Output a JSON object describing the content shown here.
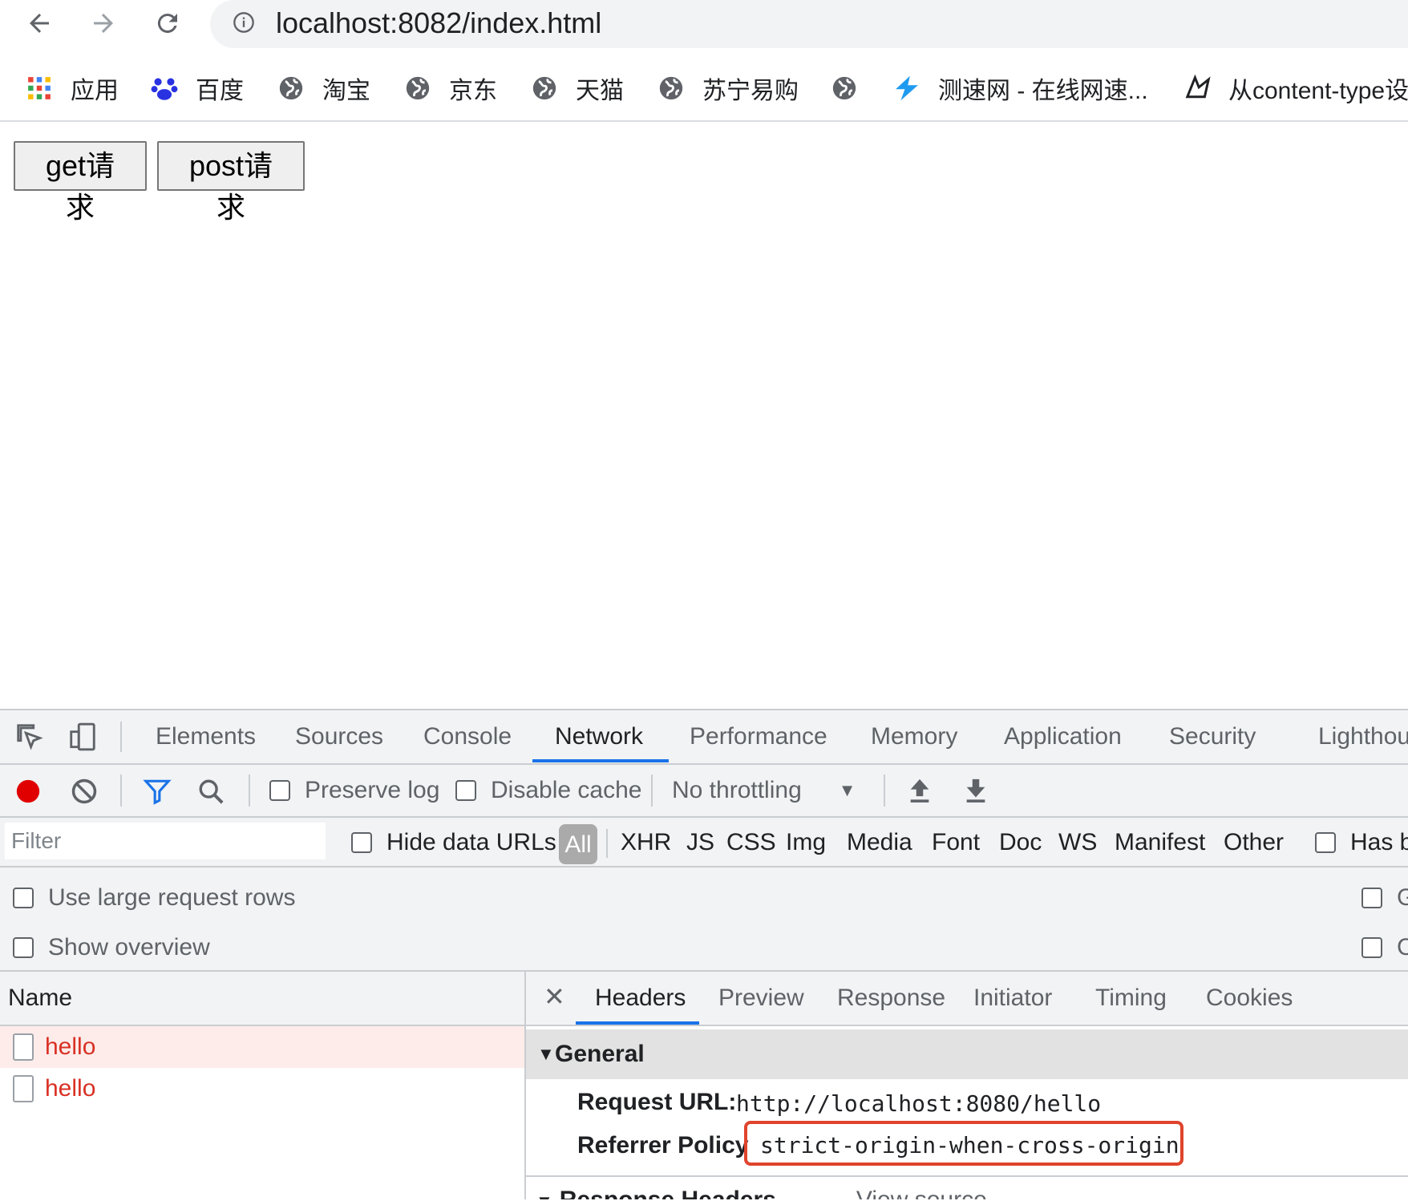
{
  "browser": {
    "url": "localhost:8082/index.html",
    "bookmarks": [
      {
        "label": "应用",
        "icon": "apps-grid-icon"
      },
      {
        "label": "百度",
        "icon": "baidu-paw-icon"
      },
      {
        "label": "淘宝",
        "icon": "globe-icon"
      },
      {
        "label": "京东",
        "icon": "globe-icon"
      },
      {
        "label": "天猫",
        "icon": "globe-icon"
      },
      {
        "label": "苏宁易购",
        "icon": "globe-icon"
      },
      {
        "label": "",
        "icon": "globe-icon"
      },
      {
        "label": "测速网 - 在线网速...",
        "icon": "speedtest-logo-icon"
      },
      {
        "label": "从content-type设",
        "icon": "bird-logo-icon"
      }
    ]
  },
  "page": {
    "get_button": "get请求",
    "post_button": "post请求"
  },
  "devtools": {
    "tabs": [
      "Elements",
      "Sources",
      "Console",
      "Network",
      "Performance",
      "Memory",
      "Application",
      "Security",
      "Lighthouse"
    ],
    "active_tab": "Network",
    "toolbar": {
      "preserve_log": "Preserve log",
      "disable_cache": "Disable cache",
      "throttling": "No throttling"
    },
    "filter": {
      "placeholder": "Filter",
      "hide_data_urls": "Hide data URLs",
      "types": [
        "All",
        "XHR",
        "JS",
        "CSS",
        "Img",
        "Media",
        "Font",
        "Doc",
        "WS",
        "Manifest",
        "Other"
      ],
      "has_blocked": "Has b"
    },
    "options": {
      "large_rows": "Use large request rows",
      "show_overview": "Show overview",
      "right_1": "G",
      "right_2": "C"
    },
    "requests": {
      "header": "Name",
      "rows": [
        "hello",
        "hello"
      ]
    },
    "detail": {
      "tabs": [
        "Headers",
        "Preview",
        "Response",
        "Initiator",
        "Timing",
        "Cookies"
      ],
      "active_tab": "Headers",
      "general_title": "General",
      "request_url_key": "Request URL:",
      "request_url_val": "http://localhost:8080/hello",
      "referrer_key": "Referrer Policy",
      "referrer_val": "strict-origin-when-cross-origin",
      "next_section": "Response Headers",
      "next_section_extra": "View source"
    }
  },
  "colors": {
    "accent": "#1a73e8",
    "error_text": "#d93025",
    "highlight": "#e0442c",
    "record": "#e00000"
  }
}
